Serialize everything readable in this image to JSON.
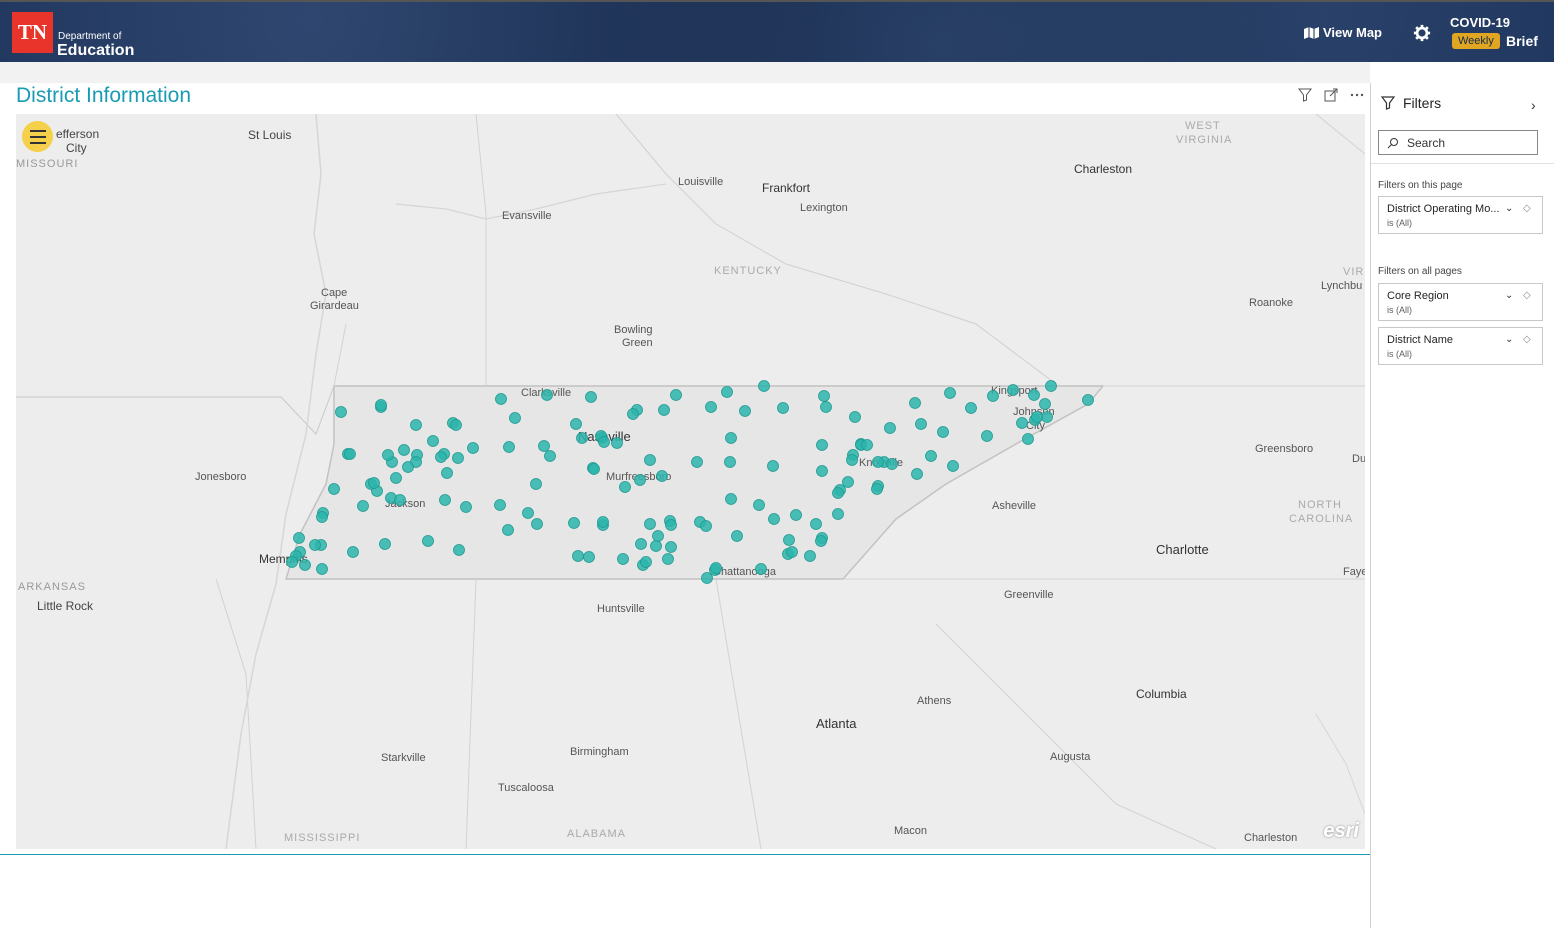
{
  "header": {
    "logo_text": "TN",
    "dept_line": "Department of",
    "edu_line": "Education",
    "view_map_label": "View Map",
    "covid_label": "COVID-19",
    "weekly_badge": "Weekly",
    "brief_label": "Brief"
  },
  "page": {
    "title": "District Information"
  },
  "map": {
    "labels": [
      {
        "t": "efferson"
      },
      {
        "t": "City"
      },
      {
        "t": "MISSOURI"
      },
      {
        "t": "St Louis"
      },
      {
        "t": "Louisville"
      },
      {
        "t": "Frankfort"
      },
      {
        "t": "Lexington"
      },
      {
        "t": "Evansville"
      },
      {
        "t": "WEST"
      },
      {
        "t": "VIRGINIA"
      },
      {
        "t": "Charleston"
      },
      {
        "t": "KENTUCKY"
      },
      {
        "t": "Cape"
      },
      {
        "t": "Girardeau"
      },
      {
        "t": "Bowling"
      },
      {
        "t": "Green"
      },
      {
        "t": "VIR"
      },
      {
        "t": "Lynchbu"
      },
      {
        "t": "Roanoke"
      },
      {
        "t": "Clarksville"
      },
      {
        "t": "Nashville"
      },
      {
        "t": "Murfreesboro"
      },
      {
        "t": "Knoxville"
      },
      {
        "t": "Kingsport"
      },
      {
        "t": "Johnson"
      },
      {
        "t": "City"
      },
      {
        "t": "Jonesboro"
      },
      {
        "t": "Jackson"
      },
      {
        "t": "Memphis"
      },
      {
        "t": "Greensboro"
      },
      {
        "t": "Du"
      },
      {
        "t": "NORTH"
      },
      {
        "t": "CAROLINA"
      },
      {
        "t": "Asheville"
      },
      {
        "t": "Charlotte"
      },
      {
        "t": "Faye"
      },
      {
        "t": "ARKANSAS"
      },
      {
        "t": "Little Rock"
      },
      {
        "t": "Chattanooga"
      },
      {
        "t": "Huntsville"
      },
      {
        "t": "Greenville"
      },
      {
        "t": "Athens"
      },
      {
        "t": "Columbia"
      },
      {
        "t": "Atlanta"
      },
      {
        "t": "Birmingham"
      },
      {
        "t": "Starkville"
      },
      {
        "t": "Augusta"
      },
      {
        "t": "Tuscaloosa"
      },
      {
        "t": "Macon"
      },
      {
        "t": "MISSISSIPPI"
      },
      {
        "t": "ALABAMA"
      },
      {
        "t": "Charleston"
      }
    ],
    "attribution": "esri",
    "marker_color": "#2bb5ab"
  },
  "filters": {
    "title": "Filters",
    "search_placeholder": "Search",
    "section_page": "Filters on this page",
    "section_all": "Filters on all pages",
    "cards": [
      {
        "name": "District Operating Mo...",
        "value": "is (All)"
      },
      {
        "name": "Core Region",
        "value": "is (All)"
      },
      {
        "name": "District Name",
        "value": "is (All)"
      }
    ]
  }
}
